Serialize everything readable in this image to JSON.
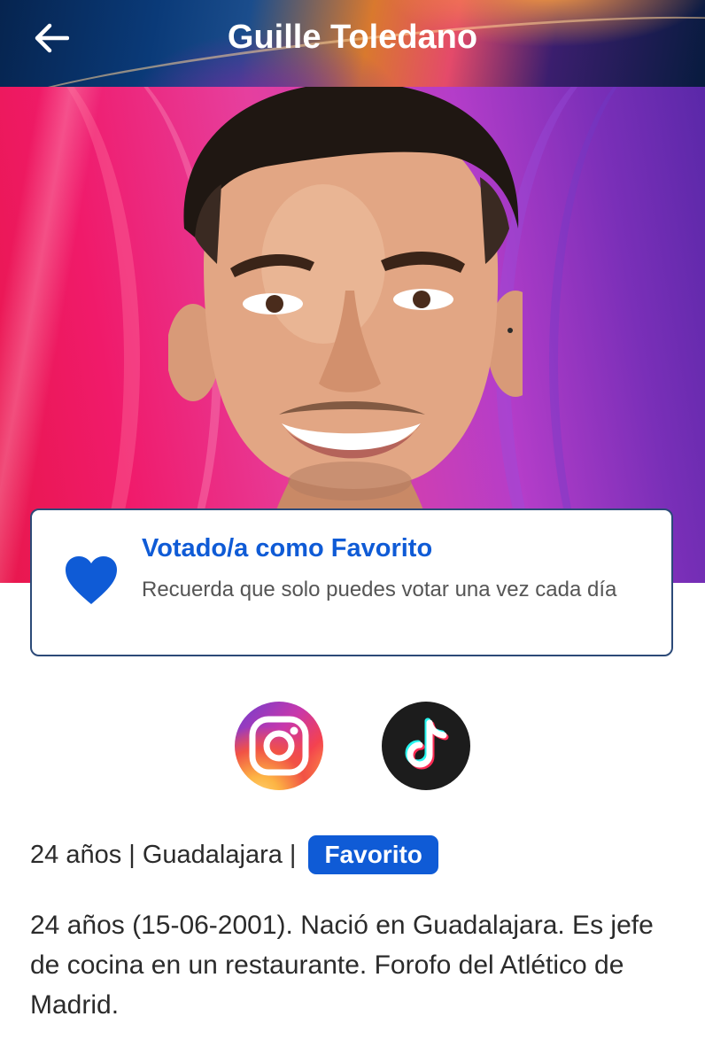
{
  "header": {
    "title": "Guille Toledano",
    "back_icon": "arrow-left-icon"
  },
  "hero": {
    "photo": "contestant-portrait"
  },
  "vote_card": {
    "icon": "heart-icon",
    "title": "Votado/a como Favorito",
    "subtitle": "Recuerda que solo puedes votar una vez cada día",
    "accent_color": "#0f5bd6"
  },
  "social": [
    {
      "name": "instagram",
      "icon": "instagram-icon"
    },
    {
      "name": "tiktok",
      "icon": "tiktok-icon"
    }
  ],
  "info": {
    "age": "24 años",
    "city": "Guadalajara",
    "badge": "Favorito"
  },
  "bio": "24 años (15-06-2001). Nació en Guadalajara. Es jefe de cocina en un restaurante. Forofo del Atlético de Madrid."
}
